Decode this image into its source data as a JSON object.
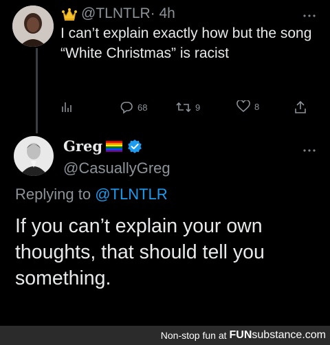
{
  "tweet": {
    "author_icon": "crown-icon",
    "handle": "@TLNTLR",
    "time": "· 4h",
    "text": "I can’t explain exactly how but the song “White Christmas” is racist",
    "replies": "68",
    "retweets": "9",
    "likes": "8"
  },
  "reply": {
    "name": "Greg",
    "badges": [
      "rainbow-flag-icon",
      "verified-badge-icon"
    ],
    "handle": "@CasuallyGreg",
    "replying_prefix": "Replying to",
    "replying_to": "@TLNTLR",
    "text": "If you can’t explain your own thoughts, that should tell you something."
  },
  "footer": {
    "prefix": "Non-stop fun at",
    "brand_bold": "FUN",
    "brand_rest": "substance",
    "suffix": ".com"
  },
  "colors": {
    "background": "#000000",
    "text": "#e7e9ea",
    "muted": "#8b9399",
    "link": "#1d9bf0",
    "verified": "#1d9bf0",
    "footer_bg": "#2b2b2b"
  }
}
